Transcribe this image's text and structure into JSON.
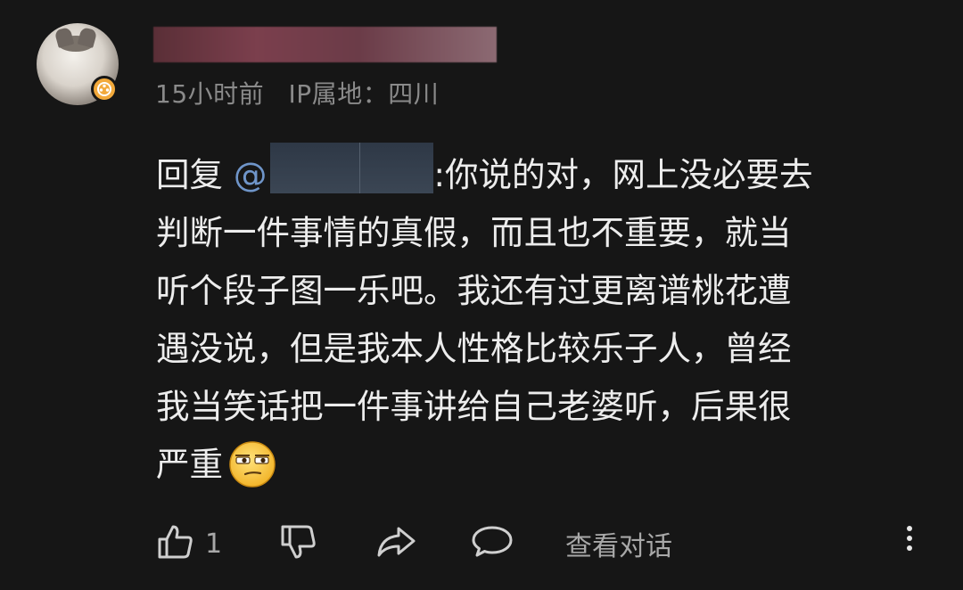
{
  "comment": {
    "meta": {
      "time": "15小时前",
      "ip_location": "IP属地：四川"
    },
    "reply_prefix": "回复",
    "mention_symbol": "@",
    "line1_after_mention": ":你说的对，网上没必要去",
    "line2": "判断一件事情的真假，而且也不重要，就当",
    "line3": "听个段子图一乐吧。我还有过更离谱桃花遭",
    "line4": "遇没说，但是我本人性格比较乐子人，曾经",
    "line5": "我当笑话把一件事讲给自己老婆听，后果很",
    "line6": "严重"
  },
  "actions": {
    "like_count": "1",
    "view_thread_label": "查看对话"
  },
  "icons": {
    "avatar_badge": "gold-badge-icon",
    "emoji": "smirk-emoji-icon",
    "like": "thumbs-up-icon",
    "dislike": "thumbs-down-icon",
    "share": "share-arrow-icon",
    "reply": "speech-bubble-icon",
    "more": "more-vertical-icon"
  },
  "colors": {
    "background": "#161616",
    "text": "#ededed",
    "meta": "#8a8a8a",
    "mention": "#6f95c9",
    "badge": "#f2a93b"
  }
}
